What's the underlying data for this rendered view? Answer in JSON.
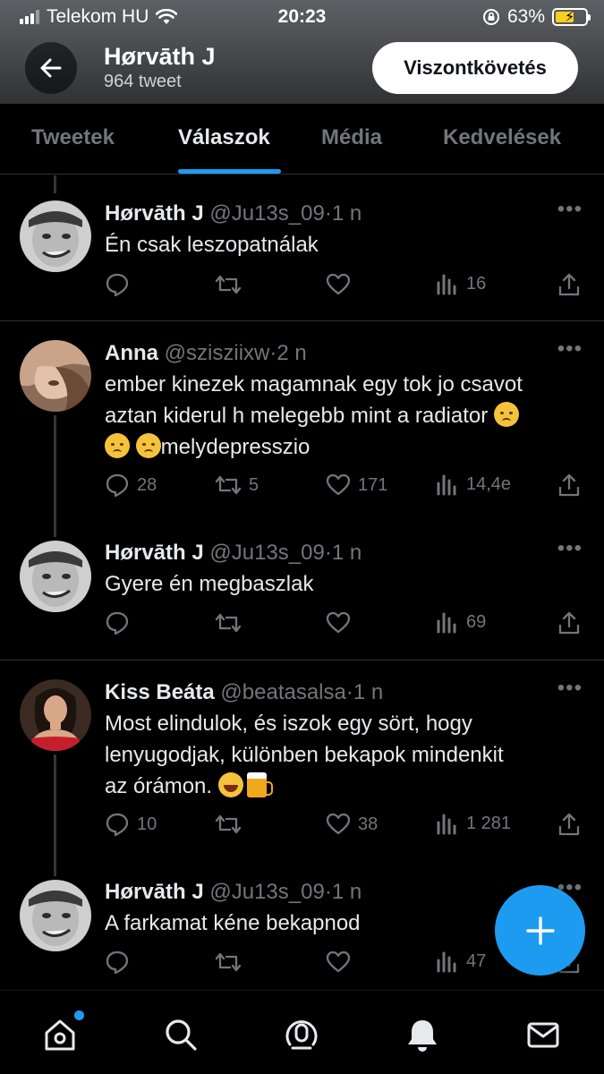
{
  "status_bar": {
    "carrier": "Telekom HU",
    "time": "20:23",
    "battery_percent": "63%",
    "battery_level": 0.63
  },
  "header": {
    "name": "Hørvāth J",
    "tweet_count": "964 tweet",
    "follow_label": "Viszontkövetés"
  },
  "tabs": [
    {
      "label": "Tweetek",
      "active": false
    },
    {
      "label": "Válaszok",
      "active": true
    },
    {
      "label": "Média",
      "active": false
    },
    {
      "label": "Kedvelések",
      "active": false
    }
  ],
  "tweets": [
    {
      "name": "Hørvāth J",
      "handle": "@Ju13s_09",
      "time": "1 n",
      "text": "Én csak leszopatnálak",
      "replies": "",
      "retweets": "",
      "likes": "",
      "views": "16"
    },
    {
      "name": "Anna",
      "handle": "@szisziixw",
      "time": "2 n",
      "text_line1": "ember kinezek magamnak egy tok jo csavot",
      "text_line2": "aztan kiderul h melegebb mint a radiator",
      "text_line3": "melydepresszio",
      "replies": "28",
      "retweets": "5",
      "likes": "171",
      "views": "14,4e"
    },
    {
      "name": "Hørvāth J",
      "handle": "@Ju13s_09",
      "time": "1 n",
      "text": "Gyere én megbaszlak",
      "replies": "",
      "retweets": "",
      "likes": "",
      "views": "69"
    },
    {
      "name": "Kiss Beáta",
      "handle": "@beatasalsa",
      "time": "1 n",
      "text_line1": "Most elindulok, és iszok egy sört, hogy",
      "text_line2": "lenyugodjak, különben bekapok mindenkit",
      "text_line3": "az órámon.",
      "replies": "10",
      "retweets": "",
      "likes": "38",
      "views": "1 281"
    },
    {
      "name": "Hørvāth J",
      "handle": "@Ju13s_09",
      "time": "1 n",
      "text": "A farkamat kéne bekapnod",
      "replies": "",
      "retweets": "",
      "likes": "",
      "views": "47"
    }
  ],
  "colors": {
    "accent": "#1d9bf0",
    "muted": "#71767b",
    "text": "#e7e9ea",
    "background": "#000000"
  },
  "bottom_nav": [
    "home-icon",
    "search-icon",
    "spaces-icon",
    "bell-icon",
    "mail-icon"
  ]
}
